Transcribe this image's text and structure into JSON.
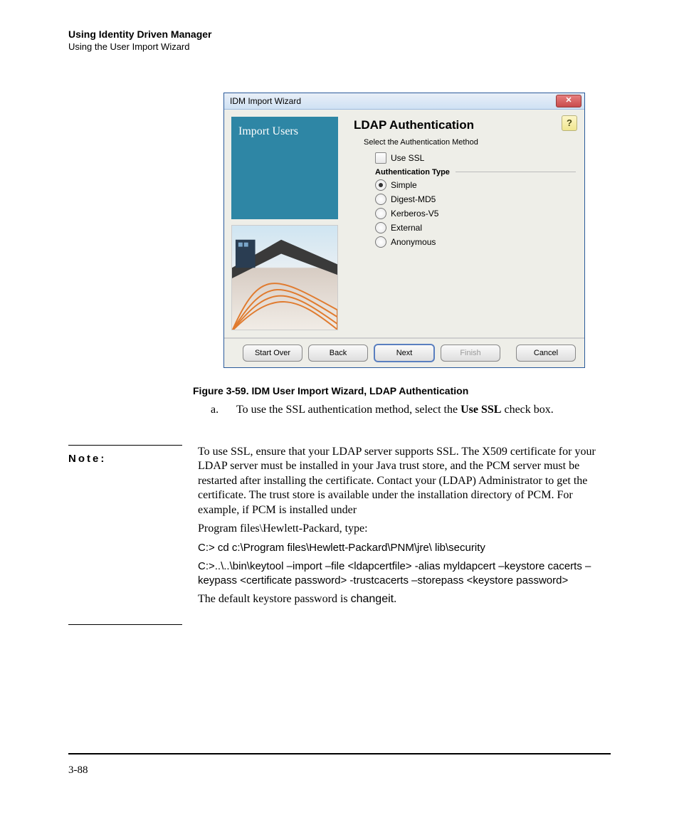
{
  "header": {
    "title": "Using Identity Driven Manager",
    "subtitle": "Using the User Import Wizard"
  },
  "wizard": {
    "window_title": "IDM Import Wizard",
    "side_title": "Import Users",
    "heading": "LDAP Authentication",
    "hint": "Select the Authentication Method",
    "use_ssl_label": "Use SSL",
    "auth_type_label": "Authentication Type",
    "options": {
      "simple": "Simple",
      "digest": "Digest-MD5",
      "kerberos": "Kerberos-V5",
      "external": "External",
      "anonymous": "Anonymous"
    },
    "buttons": {
      "start_over": "Start Over",
      "back": "Back",
      "next": "Next",
      "finish": "Finish",
      "cancel": "Cancel"
    }
  },
  "figure_caption": "Figure 3-59. IDM User Import Wizard, LDAP Authentication",
  "step": {
    "marker": "a.",
    "pre": "To use the SSL authentication method, select the ",
    "bold": "Use SSL",
    "post": " check box."
  },
  "note": {
    "label": "Note:",
    "para1": "To use SSL, ensure that your LDAP server supports SSL. The X509 certificate for your LDAP server must be installed in your Java trust store, and the PCM server must be restarted after installing the certificate. Contact your (LDAP) Administrator to get the certificate. The trust store is available under the installation directory of PCM. For example, if PCM is installed under",
    "para1b": "Program files\\Hewlett-Packard, type:",
    "cmd1": "C:> cd c:\\Program files\\Hewlett-Packard\\PNM\\jre\\ lib\\security",
    "cmd2": "C:>..\\..\\bin\\keytool –import –file <ldapcertfile> -alias myldapcert –keystore cacerts –keypass <certificate password> -trustcacerts –storepass <keystore password>",
    "tail_pre": "The default keystore password is ",
    "tail_bold": "changeit",
    "tail_post": "."
  },
  "page_number": "3-88"
}
